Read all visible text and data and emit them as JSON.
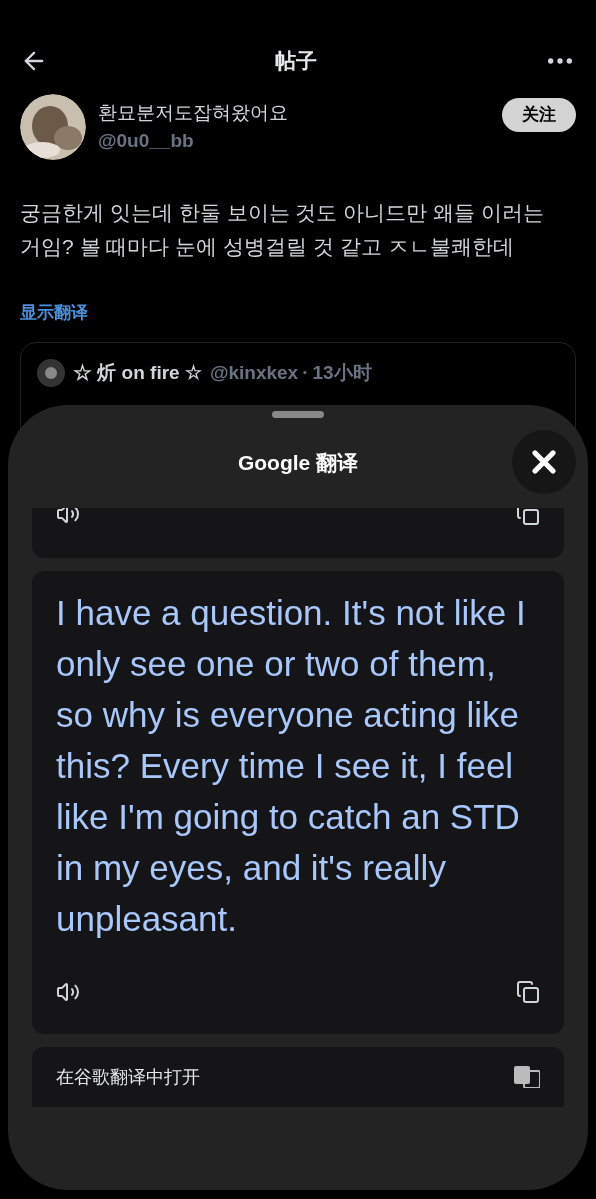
{
  "header": {
    "title": "帖子"
  },
  "post": {
    "display_name": "환묘분저도잡혀왔어요",
    "handle": "@0u0__bb",
    "follow_label": "关注",
    "text": "궁금한게 잇는데 한둘 보이는 것도 아니드만 왜들 이러는 거임? 볼 때마다 눈에 성병걸릴 것 같고 ㅈㄴ불쾌한데",
    "translate_link": "显示翻译"
  },
  "quote": {
    "name": "☆ 炘 on fire ☆",
    "handle": "@kinxkex",
    "separator": "·",
    "time": "13小时"
  },
  "sheet": {
    "title": "Google 翻译",
    "translation": "I have a question. It's not like I only see one or two of them, so why is everyone acting like this? Every time I see it, I feel like I'm going to catch an STD in my eyes, and it's really unpleasant.",
    "open_in_app": "在谷歌翻译中打开"
  }
}
